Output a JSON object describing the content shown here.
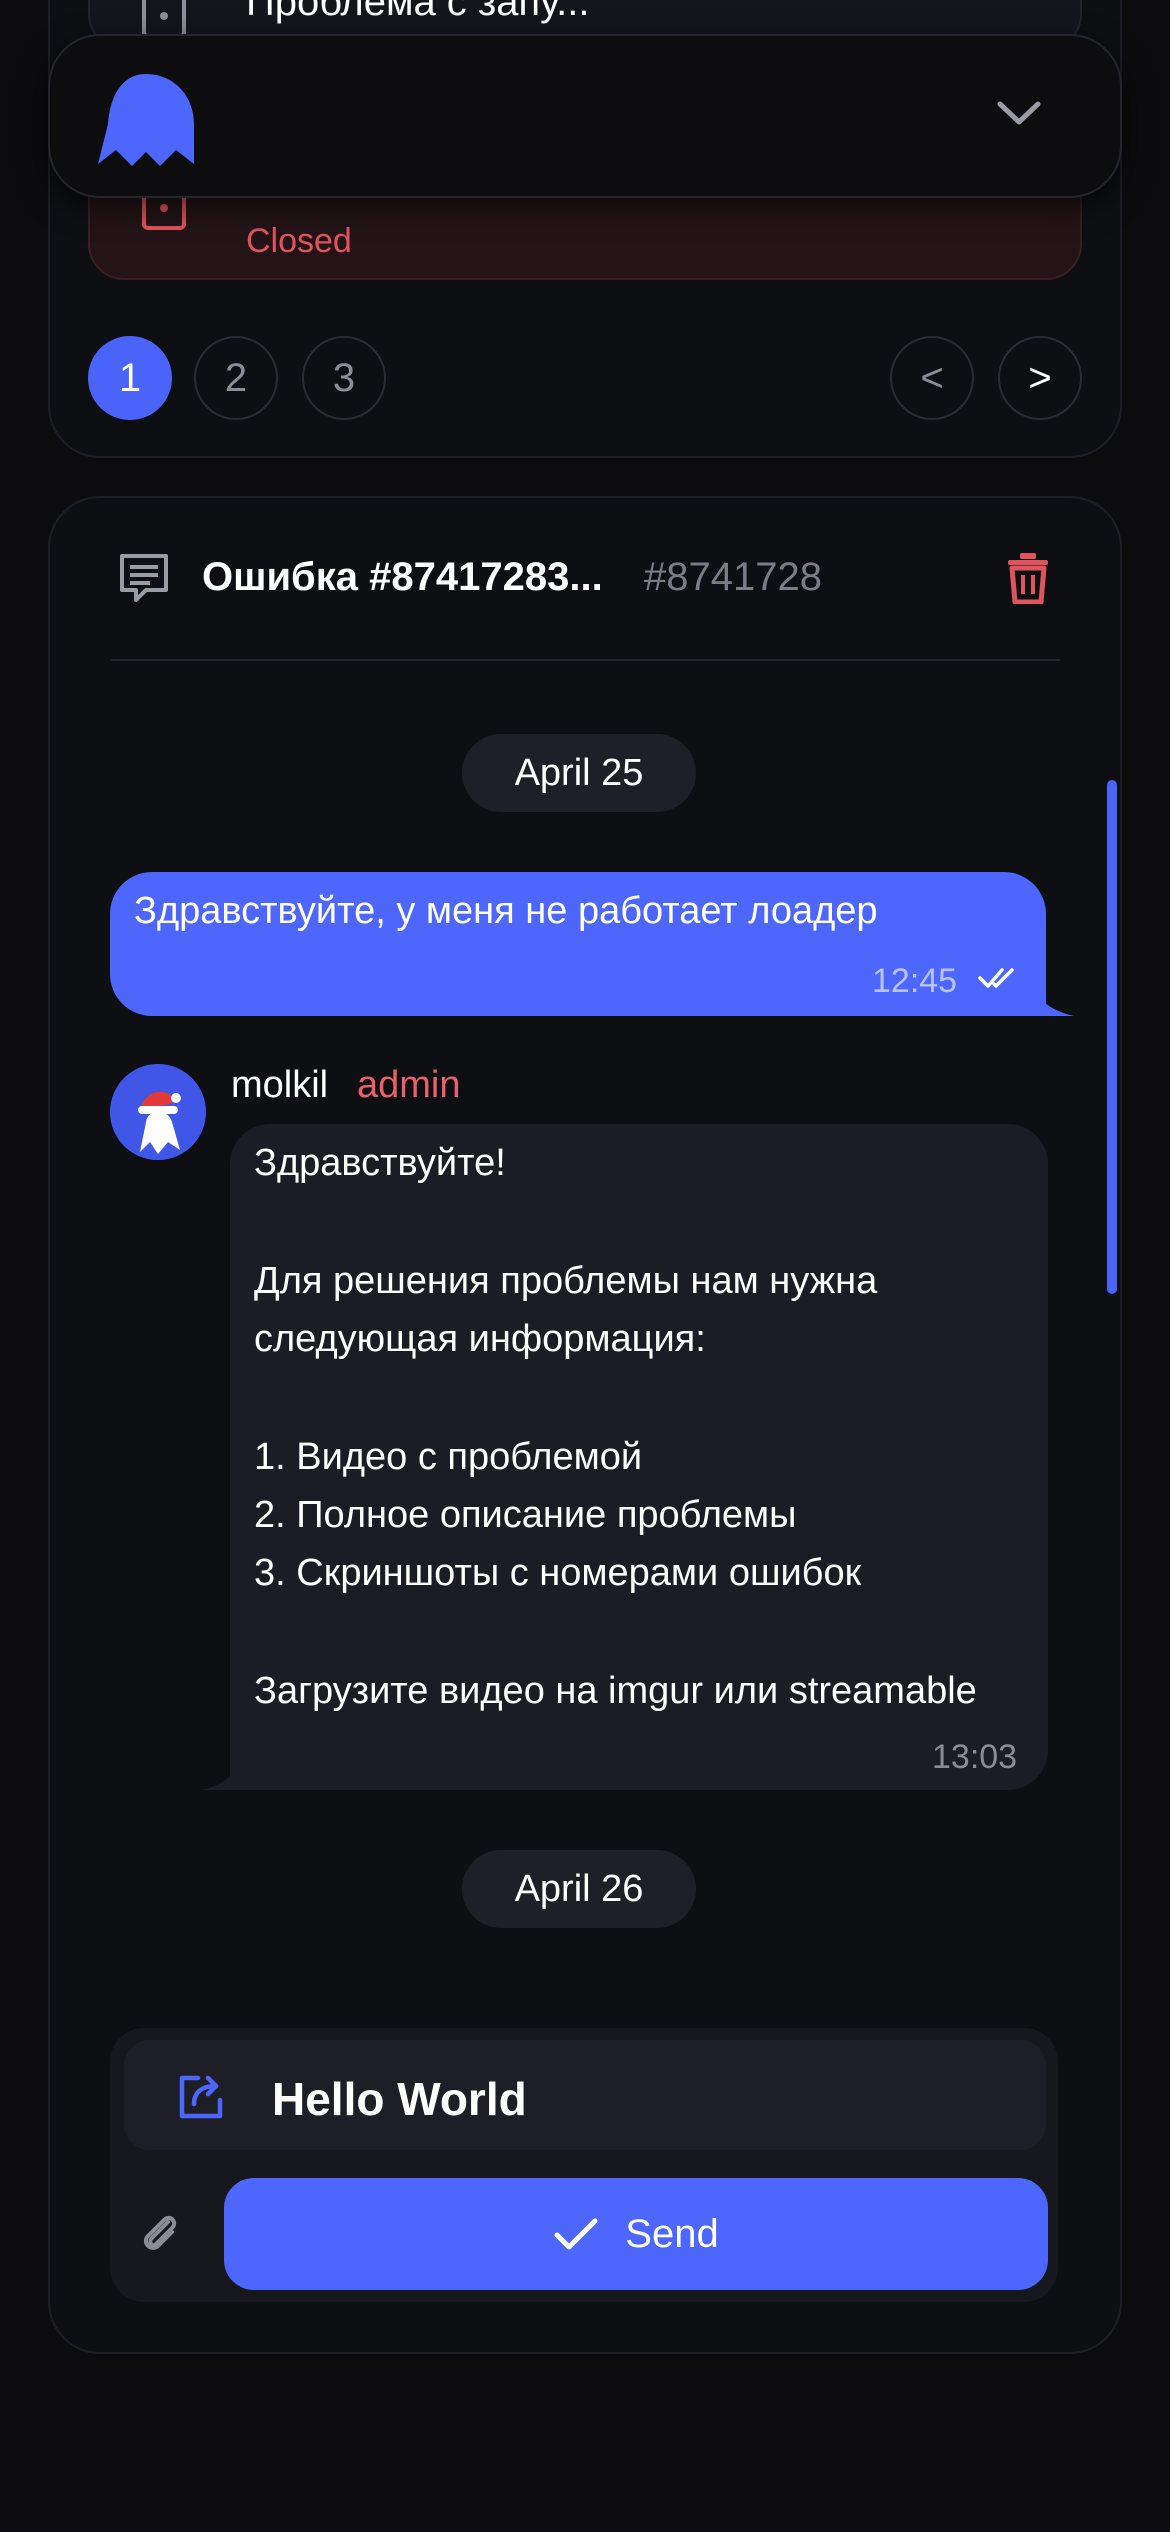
{
  "tickets": {
    "partial_title": "Проблема с запу...",
    "closed_status": "Closed",
    "pagination": {
      "pages": [
        "1",
        "2",
        "3"
      ],
      "active_page": "1",
      "prev_label": "<",
      "next_label": ">"
    }
  },
  "chat": {
    "title": "Ошибка #87417283...",
    "ticket_id": "#8741728",
    "messages": {
      "date_1": "April 25",
      "outgoing_text": "Здравствуйте, у меня не работает лоадер",
      "outgoing_time": "12:45",
      "sender_name": "molkil",
      "sender_role": "admin",
      "incoming_lines": [
        "Здравствуйте!",
        "Для решения проблемы нам нужна",
        "следующая информация:",
        "1. Видео с проблемой",
        "2. Полное описание проблемы",
        "3. Скриншоты с номерами ошибок",
        "Загрузите видео на imgur или streamable"
      ],
      "incoming_time": "13:03",
      "date_2": "April 26"
    },
    "composer": {
      "input_value": "Hello World",
      "send_label": "Send"
    }
  },
  "colors": {
    "accent": "#4d66fb",
    "danger": "#e0555d",
    "background": "#0c0c0f"
  }
}
